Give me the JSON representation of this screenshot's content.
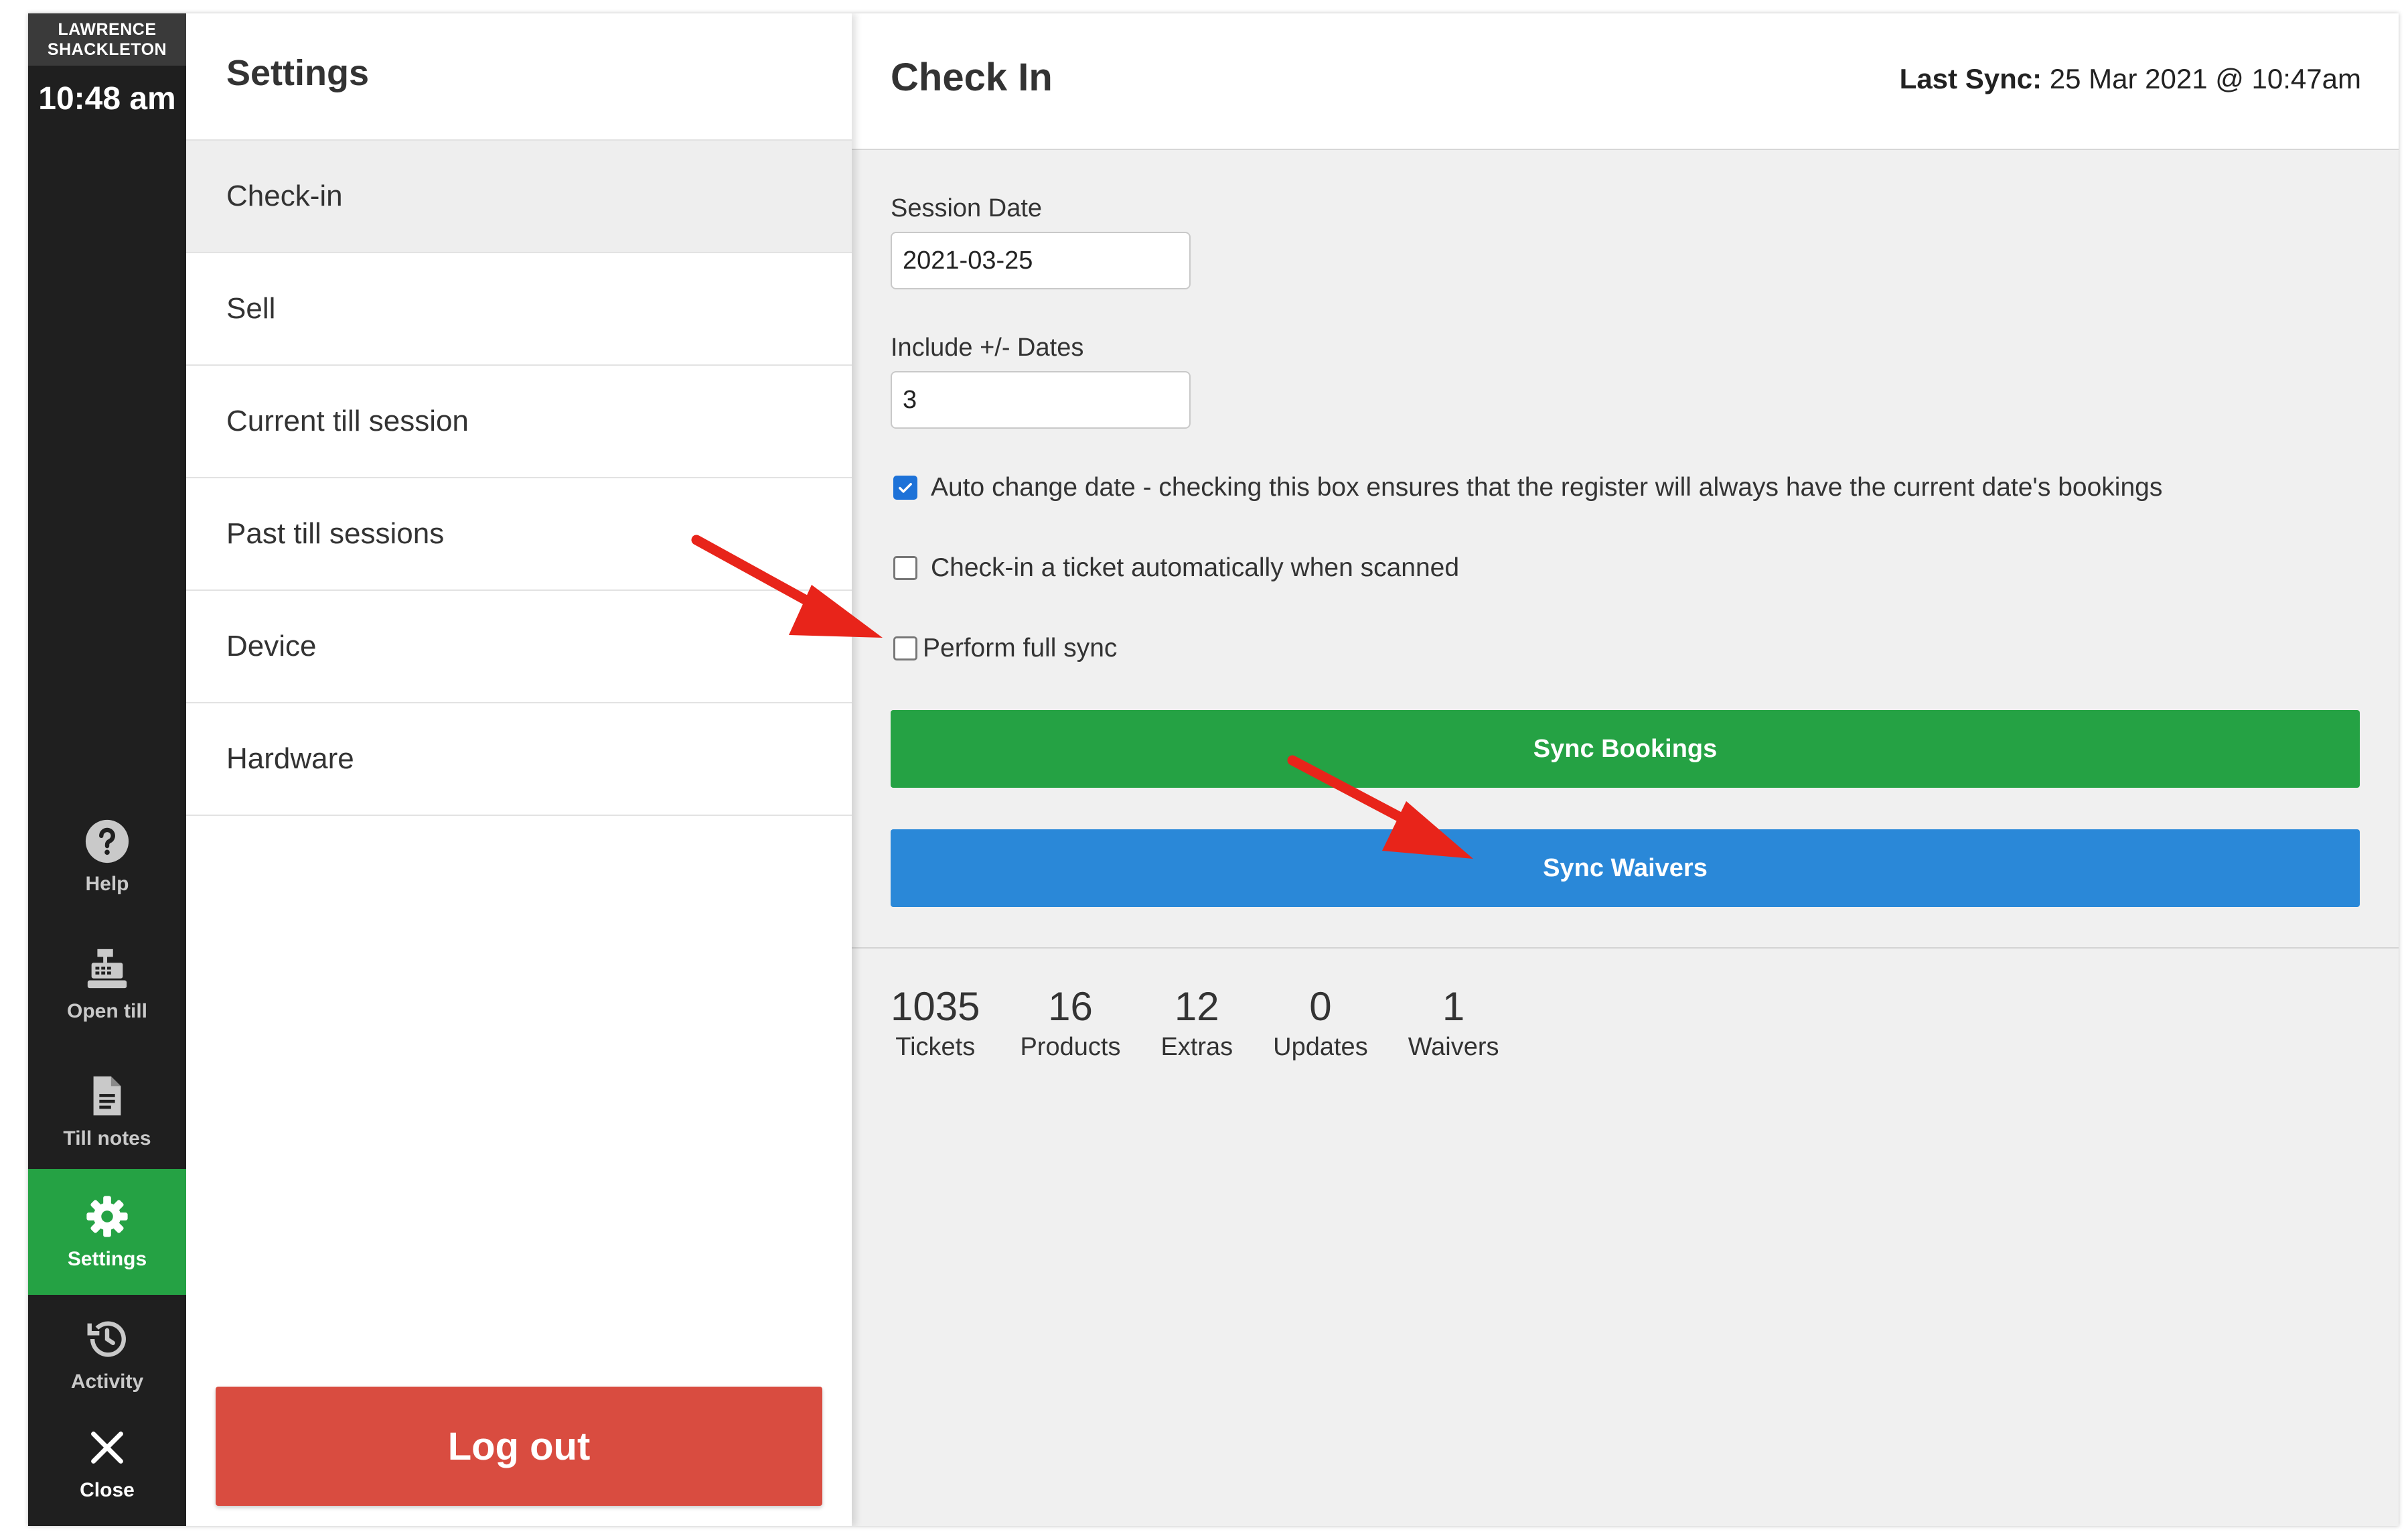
{
  "user": {
    "line1": "LAWRENCE",
    "line2": "SHACKLETON"
  },
  "clock": "10:48 am",
  "rail": [
    {
      "label": "Help",
      "icon": "help-icon"
    },
    {
      "label": "Open till",
      "icon": "cash-register-icon"
    },
    {
      "label": "Till notes",
      "icon": "document-icon"
    },
    {
      "label": "Settings",
      "icon": "gear-icon",
      "active": true
    },
    {
      "label": "Activity",
      "icon": "history-icon"
    },
    {
      "label": "Close",
      "icon": "close-icon"
    }
  ],
  "settings": {
    "title": "Settings",
    "items": [
      "Check-in",
      "Sell",
      "Current till session",
      "Past till sessions",
      "Device",
      "Hardware"
    ],
    "selected": "Check-in",
    "logout": "Log out"
  },
  "checkin": {
    "title": "Check In",
    "last_sync_label": "Last Sync:",
    "last_sync_value": "25 Mar 2021 @ 10:47am",
    "session_date_label": "Session Date",
    "session_date_value": "2021-03-25",
    "include_dates_label": "Include +/- Dates",
    "include_dates_value": "3",
    "options": [
      {
        "label": "Auto change date - checking this box ensures that the register will always have the current date's bookings",
        "checked": true
      },
      {
        "label": "Check-in a ticket automatically when scanned",
        "checked": false
      },
      {
        "label": "Perform full sync",
        "checked": false
      }
    ],
    "sync_bookings": "Sync Bookings",
    "sync_waivers": "Sync Waivers",
    "stats": [
      {
        "value": "1035",
        "label": "Tickets"
      },
      {
        "value": "16",
        "label": "Products"
      },
      {
        "value": "12",
        "label": "Extras"
      },
      {
        "value": "0",
        "label": "Updates"
      },
      {
        "value": "1",
        "label": "Waivers"
      }
    ]
  },
  "colors": {
    "green": "#25a244",
    "blue": "#2a88d8",
    "red": "#d94c40",
    "annotation": "#e8241a"
  }
}
